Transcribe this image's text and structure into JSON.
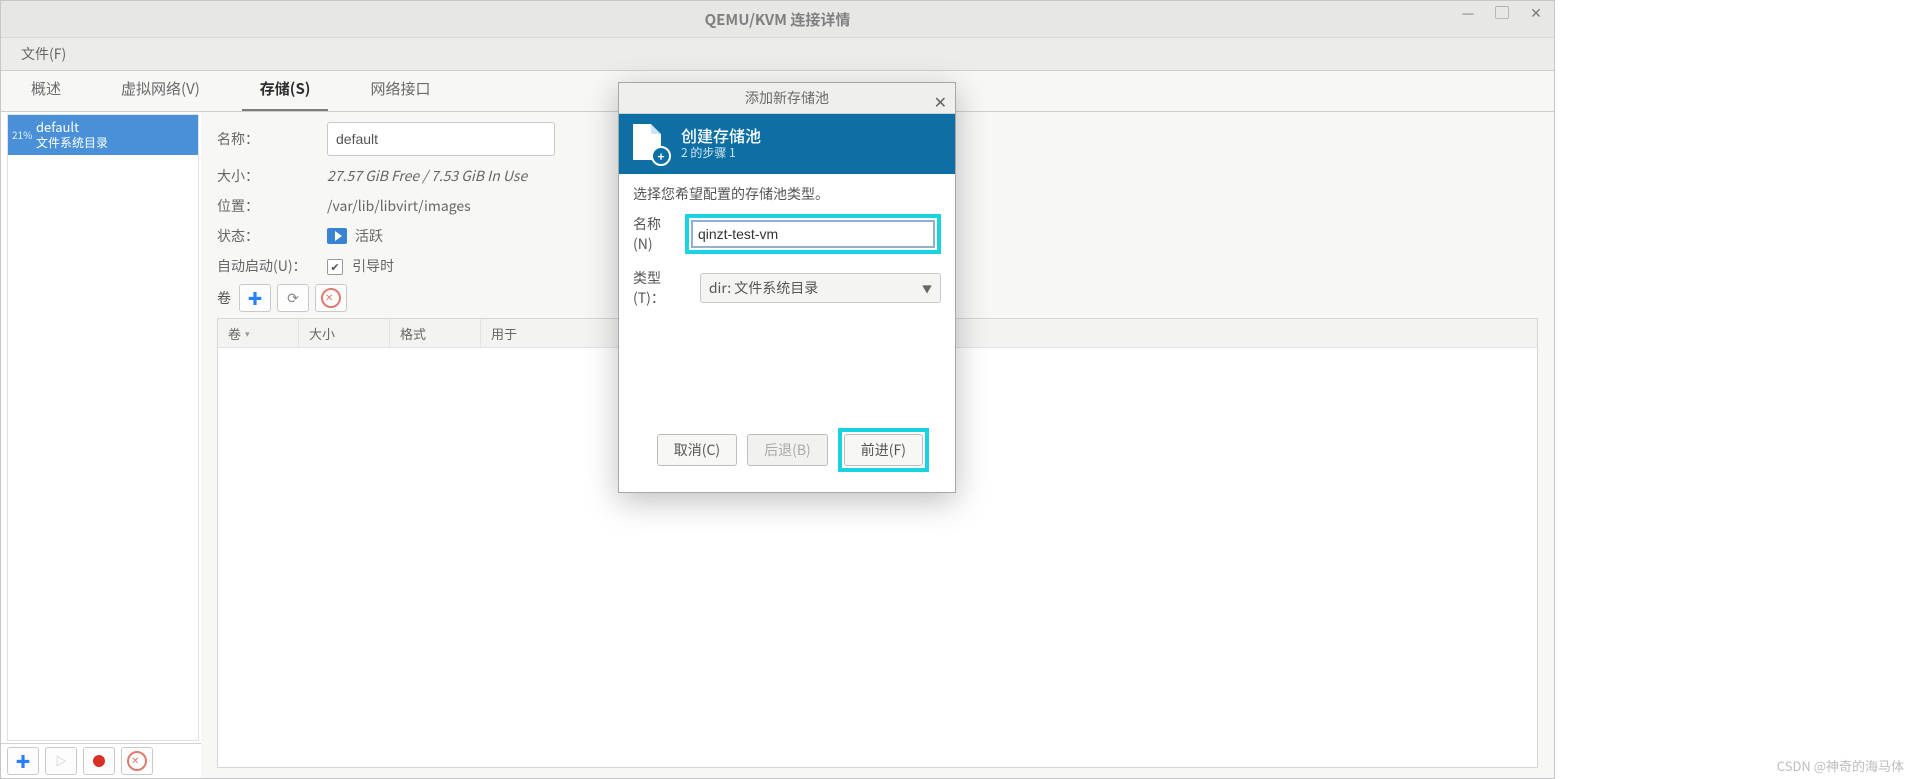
{
  "window": {
    "title": "QEMU/KVM 连接详情",
    "menu_file": "文件(F)"
  },
  "tabs": {
    "overview": "概述",
    "vnet": "虚拟网络(V)",
    "storage": "存储(S)",
    "netif": "网络接口"
  },
  "pool_list": {
    "item0": {
      "percent": "21%",
      "name": "default",
      "sub": "文件系统目录"
    }
  },
  "details": {
    "name_label": "名称：",
    "name_value": "default",
    "size_label": "大小：",
    "size_free": "27.57 GiB Free",
    "size_sep": " / ",
    "size_inuse": "7.53 GiB In Use",
    "loc_label": "位置：",
    "loc_value": "/var/lib/libvirt/images",
    "state_label": "状态：",
    "state_value": "活跃",
    "autostart_label": "自动启动(U)：",
    "autostart_value": "引导时",
    "volume_label": "卷"
  },
  "vt_cols": {
    "c0": "卷",
    "c1": "大小",
    "c2": "格式",
    "c3": "用于"
  },
  "modal": {
    "title": "添加新存储池",
    "banner_title": "创建存储池",
    "banner_sub": "2 的步骤 1",
    "desc": "选择您希望配置的存储池类型。",
    "name_label": "名称(N)",
    "name_value": "qinzt-test-vm",
    "type_label": "类型(T)：",
    "type_value": "dir: 文件系统目录",
    "btn_cancel": "取消(C)",
    "btn_back": "后退(B)",
    "btn_forward": "前进(F)"
  },
  "watermark": "CSDN @神奇的海马体"
}
